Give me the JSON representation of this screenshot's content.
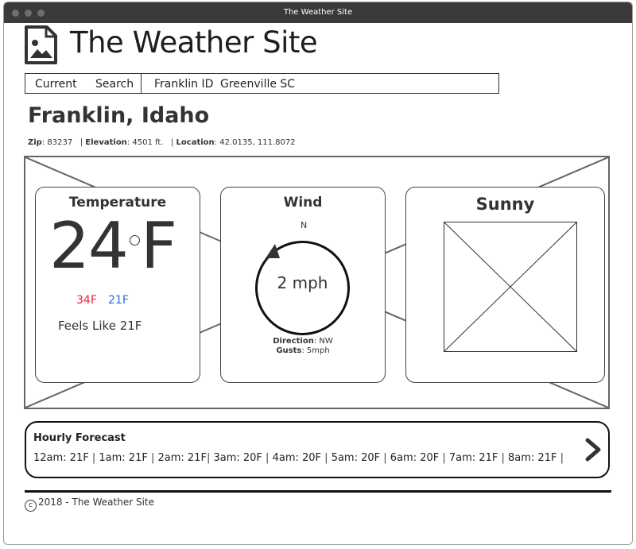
{
  "window": {
    "title": "The Weather Site"
  },
  "header": {
    "site_title": "The Weather Site",
    "logo_icon": "image-file-icon"
  },
  "nav": {
    "items": [
      {
        "label": "Current"
      },
      {
        "label": "Search"
      },
      {
        "label": "Franklin ID"
      },
      {
        "label": "Greenville SC"
      }
    ]
  },
  "location": {
    "name": "Franklin, Idaho",
    "zip_label": "Zip",
    "zip": ": 83237",
    "elevation_label": "Elevation",
    "elevation": ": 4501 ft.",
    "location_label": "Location",
    "coords": ": 42.0135, 111.8072"
  },
  "temperature": {
    "title": "Temperature",
    "value": "24",
    "unit": "F",
    "high": "34F",
    "low": "21F",
    "feels_like": "Feels Like 21F",
    "high_color": "#e8233f",
    "low_color": "#1f6fe0"
  },
  "wind": {
    "title": "Wind",
    "compass_label": "N",
    "speed": "2 mph",
    "direction_label": "Direction",
    "direction": ": NW",
    "gusts_label": "Gusts",
    "gusts": ": 5mph"
  },
  "condition": {
    "title": "Sunny",
    "icon": "weather-image-placeholder"
  },
  "hourly": {
    "title": "Hourly Forecast",
    "entries": [
      "12am: 21F",
      "1am: 21F",
      "2am: 21F",
      "3am: 20F",
      "4am: 20F",
      "5am: 20F",
      "6am: 20F",
      "7am:  21F",
      "8am:  21F"
    ],
    "next_icon": "chevron-right-icon"
  },
  "footer": {
    "copyright": "2018 - The Weather Site"
  }
}
